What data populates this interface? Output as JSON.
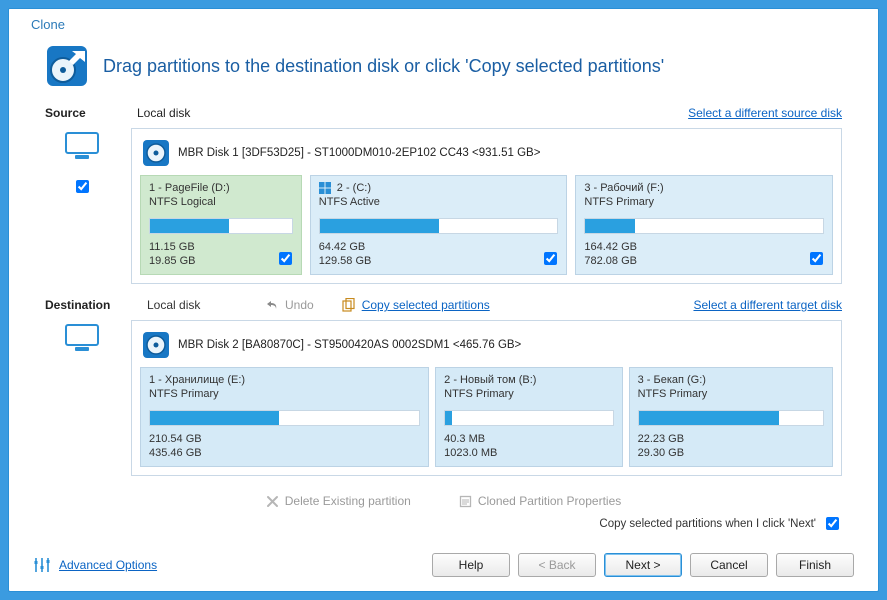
{
  "window": {
    "title": "Clone"
  },
  "header": {
    "title": "Drag partitions to the destination disk or click 'Copy selected partitions'"
  },
  "source": {
    "label": "Source",
    "local": "Local disk",
    "different_link": "Select a different source disk",
    "disk_title": "MBR Disk 1 [3DF53D25] - ST1000DM010-2EP102 CC43  <931.51 GB>",
    "partitions": [
      {
        "title": "1 - PageFile (D:)",
        "sub": "NTFS Logical",
        "used": "11.15 GB",
        "total": "19.85 GB",
        "fill_pct": 56
      },
      {
        "title": "2 -  (C:)",
        "sub": "NTFS Active",
        "used": "64.42 GB",
        "total": "129.58 GB",
        "fill_pct": 50,
        "is_windows": true
      },
      {
        "title": "3 - Рабочий (F:)",
        "sub": "NTFS Primary",
        "used": "164.42 GB",
        "total": "782.08 GB",
        "fill_pct": 21
      }
    ]
  },
  "mid": {
    "dest_label": "Destination",
    "local": "Local disk",
    "undo": "Undo",
    "copy_link": "Copy selected partitions",
    "different_link": "Select a different target disk"
  },
  "destination": {
    "disk_title": "MBR Disk 2 [BA80870C] - ST9500420AS 0002SDM1  <465.76 GB>",
    "partitions": [
      {
        "title": "1 - Хранилище (E:)",
        "sub": "NTFS Primary",
        "used": "210.54 GB",
        "total": "435.46 GB",
        "fill_pct": 48
      },
      {
        "title": "2 - Новый том (B:)",
        "sub": "NTFS Primary",
        "used": "40.3 MB",
        "total": "1023.0 MB",
        "fill_pct": 4
      },
      {
        "title": "3 - Бекап (G:)",
        "sub": "NTFS Primary",
        "used": "22.23 GB",
        "total": "29.30 GB",
        "fill_pct": 76
      }
    ]
  },
  "lower": {
    "delete_existing": "Delete Existing partition",
    "cloned_props": "Cloned Partition Properties"
  },
  "copynote": {
    "text": "Copy selected partitions when I click 'Next'"
  },
  "footer": {
    "advanced": "Advanced Options",
    "help": "Help",
    "back": "< Back",
    "next": "Next >",
    "cancel": "Cancel",
    "finish": "Finish"
  }
}
